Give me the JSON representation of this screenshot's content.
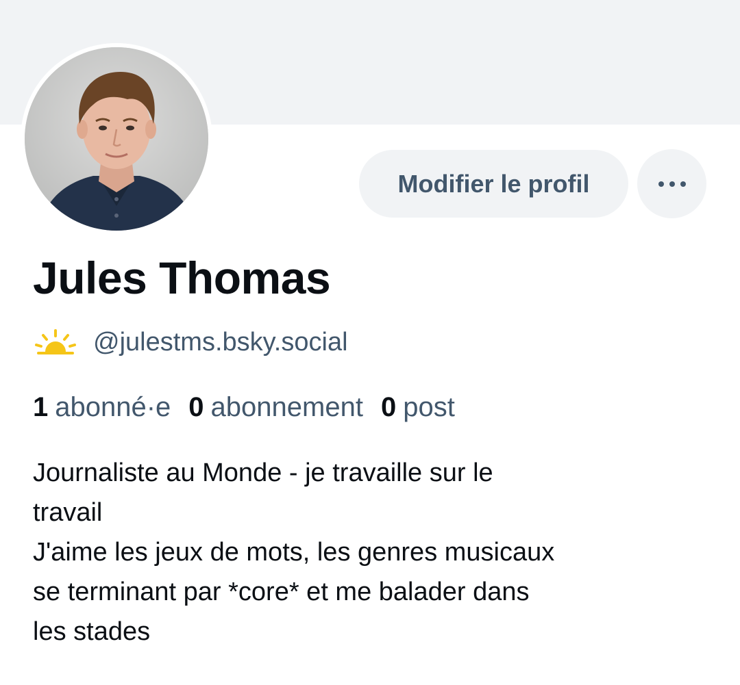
{
  "profile": {
    "display_name": "Jules Thomas",
    "handle": "@julestms.bsky.social",
    "handle_icon": "sun-icon",
    "avatar": "avatar-photo"
  },
  "actions": {
    "edit_label": "Modifier le profil",
    "more_icon": "more-dots-icon"
  },
  "stats": {
    "followers_count": "1",
    "followers_label": "abonné·e",
    "following_count": "0",
    "following_label": "abonnement",
    "posts_count": "0",
    "posts_label": "post"
  },
  "bio": {
    "lines": [
      "Journaliste au Monde - je travaille sur le",
      "travail",
      "J'aime les jeux de mots, les genres musicaux",
      "se terminant par *core* et me balader dans",
      "les stades"
    ]
  },
  "colors": {
    "banner": "#f1f3f5",
    "muted_text": "#42576c",
    "primary_text": "#0b0f14",
    "button_bg": "#f1f3f5",
    "sun": "#f5c518"
  }
}
